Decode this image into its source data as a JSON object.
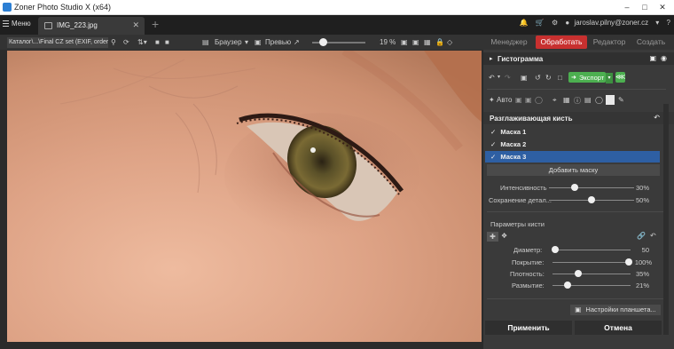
{
  "window": {
    "title": "Zoner Photo Studio X (x64)"
  },
  "tabbar": {
    "menu_label": "Меню",
    "doc_tab_label": "IMG_223.jpg",
    "user_email": "jaroslav.pilny@zoner.cz"
  },
  "toolbar": {
    "catalog_path": "Каталог\\...\\Final CZ set (EXIF, order)",
    "browser_label": "Браузер",
    "preview_label": "Превью",
    "zoom_value": "19 %"
  },
  "modes": {
    "manager": "Менеджер",
    "edit": "Обработать",
    "editor": "Редактор",
    "create": "Создать"
  },
  "panel": {
    "histogram_title": "Гистограмма",
    "export_label": "Экспорт",
    "auto_label": "Авто",
    "brush_title": "Разглаживающая кисть",
    "masks": [
      {
        "label": "Маска 1",
        "checked": true,
        "selected": false
      },
      {
        "label": "Маска 2",
        "checked": true,
        "selected": false
      },
      {
        "label": "Маска 3",
        "checked": true,
        "selected": true
      }
    ],
    "add_mask_label": "Добавить маску",
    "intensity": {
      "label": "Интенсивность",
      "value": "30%",
      "level": 0.3
    },
    "detail": {
      "label": "Сохранение детал...",
      "value": "50%",
      "level": 0.5
    },
    "brush_params_title": "Параметры кисти",
    "diameter": {
      "label": "Диаметр:",
      "value": "50",
      "level": 0.05
    },
    "coverage": {
      "label": "Покрытие:",
      "value": "100%",
      "level": 1.0
    },
    "density": {
      "label": "Плотность:",
      "value": "35%",
      "level": 0.35
    },
    "feather": {
      "label": "Размытие:",
      "value": "21%",
      "level": 0.21
    },
    "tablet_settings_label": "Настройки планшета...",
    "apply_label": "Применить",
    "cancel_label": "Отмена"
  },
  "colors": {
    "accent_red": "#c8302f",
    "export_green": "#4caf50",
    "mask_selected": "#2e5fa3"
  }
}
